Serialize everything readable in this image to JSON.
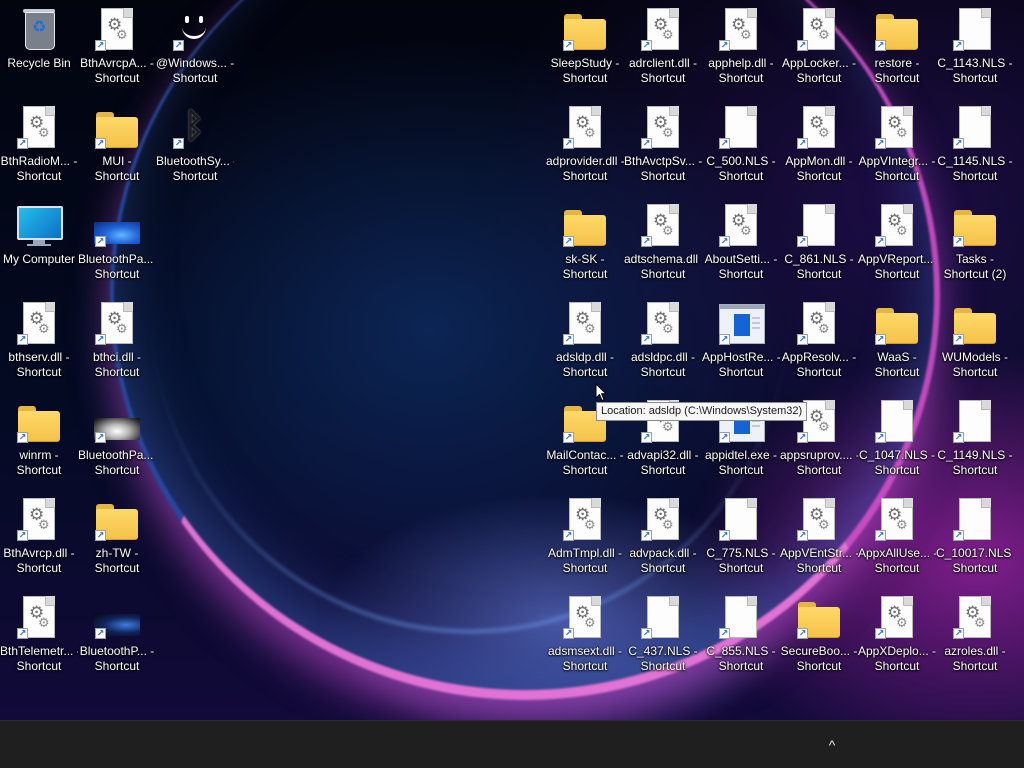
{
  "desktop": {
    "icons": [
      {
        "label": "Recycle Bin",
        "type": "bin",
        "shortcut": false
      },
      {
        "label": "BthAvrcpA... - Shortcut",
        "type": "dll",
        "shortcut": true
      },
      {
        "label": "@Windows... - Shortcut",
        "type": "smile",
        "shortcut": true
      },
      {
        "label": "SleepStudy - Shortcut",
        "type": "folder",
        "shortcut": true
      },
      {
        "label": "adrclient.dll - Shortcut",
        "type": "dll",
        "shortcut": true
      },
      {
        "label": "apphelp.dll - Shortcut",
        "type": "dll",
        "shortcut": true
      },
      {
        "label": "AppLocker... - Shortcut",
        "type": "dll",
        "shortcut": true
      },
      {
        "label": "restore - Shortcut",
        "type": "folder",
        "shortcut": true
      },
      {
        "label": "C_1143.NLS - Shortcut",
        "type": "doc",
        "shortcut": true
      },
      {
        "label": "BthRadioM... - Shortcut",
        "type": "dll",
        "shortcut": true
      },
      {
        "label": "MUI - Shortcut",
        "type": "folder",
        "shortcut": true
      },
      {
        "label": "BluetoothSy... - Shortcut",
        "type": "bt",
        "shortcut": true
      },
      {
        "label": "adprovider.dll - Shortcut",
        "type": "dll",
        "shortcut": true
      },
      {
        "label": "BthAvctpSv... - Shortcut",
        "type": "dll",
        "shortcut": true
      },
      {
        "label": "C_500.NLS - Shortcut",
        "type": "doc",
        "shortcut": true
      },
      {
        "label": "AppMon.dll - Shortcut",
        "type": "dll",
        "shortcut": true
      },
      {
        "label": "AppVIntegr... - Shortcut",
        "type": "dll",
        "shortcut": true
      },
      {
        "label": "C_1145.NLS - Shortcut",
        "type": "doc",
        "shortcut": true
      },
      {
        "label": "My Computer",
        "type": "monitor",
        "shortcut": false
      },
      {
        "label": "BluetoothPa... - Shortcut",
        "type": "thumb-blue",
        "shortcut": true
      },
      {
        "label": "sk-SK - Shortcut",
        "type": "folder",
        "shortcut": true
      },
      {
        "label": "adtschema.dll - Shortcut",
        "type": "dll",
        "shortcut": true
      },
      {
        "label": "AboutSetti... - Shortcut",
        "type": "dll",
        "shortcut": true
      },
      {
        "label": "C_861.NLS - Shortcut",
        "type": "doc",
        "shortcut": true
      },
      {
        "label": "AppVReport... - Shortcut",
        "type": "dll",
        "shortcut": true
      },
      {
        "label": "Tasks - Shortcut (2)",
        "type": "folder",
        "shortcut": true
      },
      {
        "label": "bthserv.dll - Shortcut",
        "type": "dll",
        "shortcut": true
      },
      {
        "label": "bthci.dll - Shortcut",
        "type": "dll",
        "shortcut": true
      },
      {
        "label": "adsldp.dll - Shortcut",
        "type": "dll",
        "shortcut": true
      },
      {
        "label": "adsldpc.dll - Shortcut",
        "type": "dll",
        "shortcut": true
      },
      {
        "label": "AppHostRe... - Shortcut",
        "type": "apphost",
        "shortcut": true
      },
      {
        "label": "AppResolv... - Shortcut",
        "type": "dll",
        "shortcut": true
      },
      {
        "label": "WaaS - Shortcut",
        "type": "folder",
        "shortcut": true
      },
      {
        "label": "WUModels - Shortcut",
        "type": "folder",
        "shortcut": true
      },
      {
        "label": "winrm - Shortcut",
        "type": "folder",
        "shortcut": true
      },
      {
        "label": "BluetoothPa... - Shortcut",
        "type": "thumb-grey",
        "shortcut": true
      },
      {
        "label": "MailContac... - Shortcut",
        "type": "folder",
        "shortcut": true
      },
      {
        "label": "advapi32.dll - Shortcut",
        "type": "dll",
        "shortcut": true
      },
      {
        "label": "appidtel.exe - Shortcut",
        "type": "apphost",
        "shortcut": true
      },
      {
        "label": "appsruprov.... - Shortcut",
        "type": "dll",
        "shortcut": true
      },
      {
        "label": "C_1047.NLS - Shortcut",
        "type": "doc",
        "shortcut": true
      },
      {
        "label": "C_1149.NLS - Shortcut",
        "type": "doc",
        "shortcut": true
      },
      {
        "label": "BthAvrcp.dll - Shortcut",
        "type": "dll",
        "shortcut": true
      },
      {
        "label": "zh-TW - Shortcut",
        "type": "folder",
        "shortcut": true
      },
      {
        "label": "AdmTmpl.dll - Shortcut",
        "type": "dll",
        "shortcut": true
      },
      {
        "label": "advpack.dll - Shortcut",
        "type": "dll",
        "shortcut": true
      },
      {
        "label": "C_775.NLS - Shortcut",
        "type": "doc",
        "shortcut": true
      },
      {
        "label": "AppVEntStr... - Shortcut",
        "type": "dll",
        "shortcut": true
      },
      {
        "label": "AppxAllUse... - Shortcut",
        "type": "dll",
        "shortcut": true
      },
      {
        "label": "C_10017.NLS - Shortcut",
        "type": "doc",
        "shortcut": true
      },
      {
        "label": "BthTelemetr... - Shortcut",
        "type": "dll",
        "shortcut": true
      },
      {
        "label": "BluetoothP... - Shortcut",
        "type": "thumb-dark",
        "shortcut": true
      },
      {
        "label": "adsmsext.dll - Shortcut",
        "type": "dll",
        "shortcut": true
      },
      {
        "label": "C_437.NLS - Shortcut",
        "type": "doc",
        "shortcut": true
      },
      {
        "label": "C_855.NLS - Shortcut",
        "type": "doc",
        "shortcut": true
      },
      {
        "label": "SecureBoo... - Shortcut",
        "type": "folder",
        "shortcut": true
      },
      {
        "label": "AppXDeplo... - Shortcut",
        "type": "dll",
        "shortcut": true
      },
      {
        "label": "azroles.dll - Shortcut",
        "type": "dll",
        "shortcut": true
      }
    ]
  },
  "tooltip": {
    "text": "Location: adsldp (C:\\Windows\\System32)"
  },
  "taskbar": {
    "tray_chevron": "^"
  },
  "colors": {
    "folder": "#f4c24a",
    "accent": "#1d6fd8",
    "taskbar": "#1f1f1f"
  }
}
